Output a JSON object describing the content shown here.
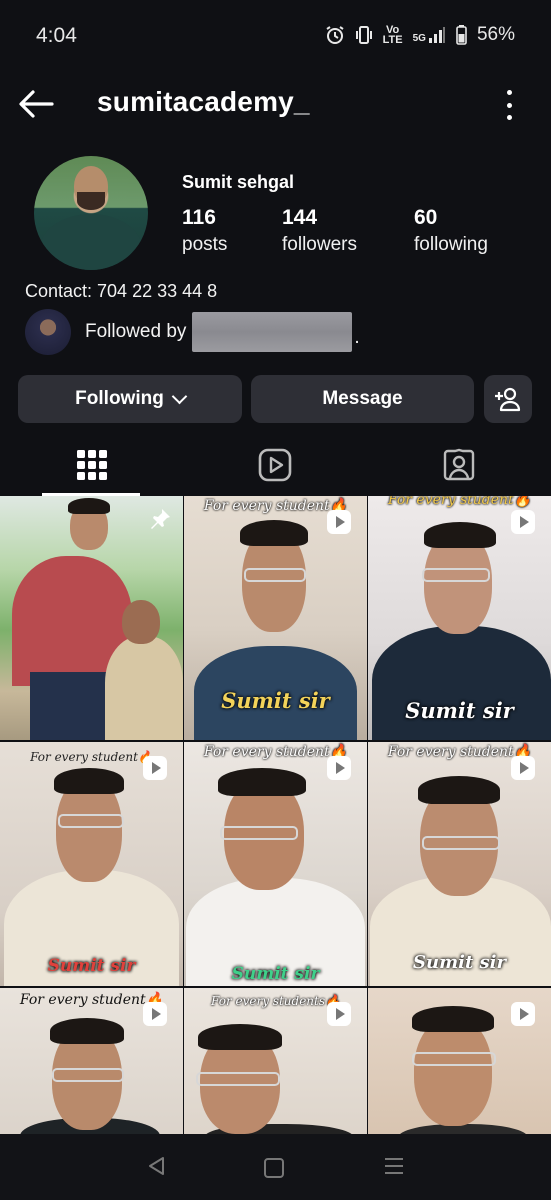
{
  "status_bar": {
    "time": "4:04",
    "network_top": "Vo",
    "network_bottom": "LTE",
    "signal": "5G",
    "battery": "56%",
    "icons": [
      "alarm-icon",
      "vibrate-icon",
      "signal-icon",
      "battery-icon"
    ]
  },
  "header": {
    "username": "sumitacademy_",
    "back_icon": "arrow-left-icon",
    "menu_icon": "more-vertical-icon"
  },
  "profile": {
    "display_name": "Sumit sehgal",
    "stats": [
      {
        "value": "116",
        "label": "posts"
      },
      {
        "value": "144",
        "label": "followers"
      },
      {
        "value": "60",
        "label": "following"
      }
    ],
    "contact": "Contact: 704 22 33 44 8",
    "followed_by_prefix": "Followed by",
    "followed_by_suffix": "."
  },
  "actions": {
    "following_label": "Following",
    "message_label": "Message",
    "add_user_icon": "person-add-icon"
  },
  "tabs": [
    {
      "icon": "grid-icon",
      "active": true
    },
    {
      "icon": "reels-icon",
      "active": false
    },
    {
      "icon": "tagged-icon",
      "active": false
    }
  ],
  "posts": [
    {
      "caption": "",
      "name": "",
      "pinned": true
    },
    {
      "caption": "For every student🔥",
      "name": "Sumit sir"
    },
    {
      "caption": "For every student🔥",
      "name": "Sumit sir"
    },
    {
      "caption": "For every student🔥",
      "name": "Sumit sir"
    },
    {
      "caption": "For every student🔥",
      "name": "Sumit sir"
    },
    {
      "caption": "For every student🔥",
      "name": "Sumit sir"
    },
    {
      "caption": "For every student🔥",
      "name": ""
    },
    {
      "caption": "For every students🔥",
      "name": ""
    },
    {
      "caption": "",
      "name": ""
    }
  ],
  "colors": {
    "background": "#0f1014",
    "button": "#2e2f36",
    "text": "#ffffff",
    "label_yellow": "#f3d35a",
    "label_red": "#e0413c",
    "label_green": "#3fd08a"
  }
}
